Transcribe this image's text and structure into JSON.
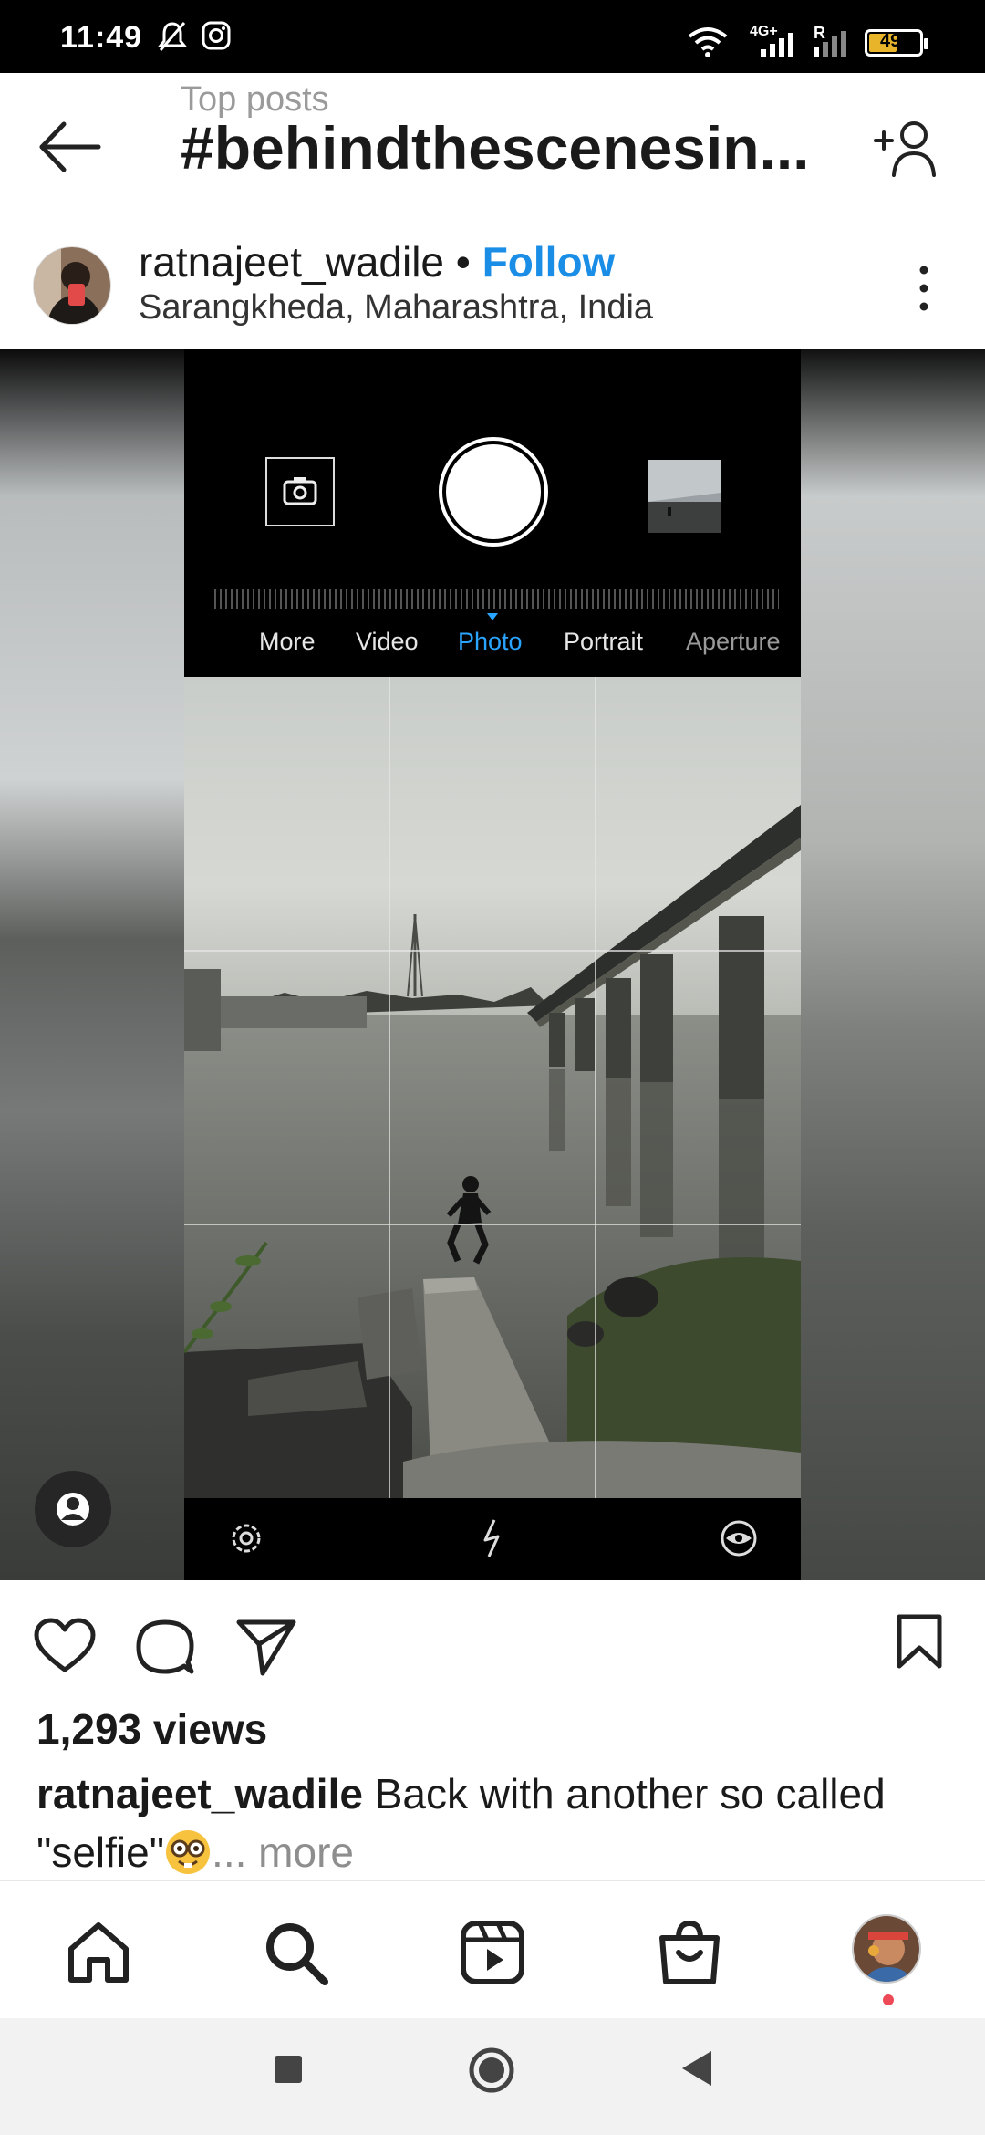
{
  "status_bar": {
    "time": "11:49",
    "network_label": "4G+",
    "roaming_label": "R",
    "battery": "49",
    "icons": [
      "bell-off-icon",
      "instagram-icon",
      "wifi-icon",
      "signal-icon",
      "battery-icon"
    ]
  },
  "header": {
    "subtitle": "Top posts",
    "title": "#behindthescenesin...",
    "icons": [
      "back-arrow-icon",
      "add-person-icon"
    ]
  },
  "post": {
    "username": "ratnajeet_wadile",
    "separator": "•",
    "follow_label": "Follow",
    "location": "Sarangkheda, Maharashtra, India",
    "camera_modes": [
      "More",
      "Video",
      "Photo",
      "Portrait",
      "Aperture"
    ],
    "active_mode": "Photo",
    "views": "1,293 views",
    "caption_user": "ratnajeet_wadile",
    "caption_text": "Back with another so called \"selfie\"",
    "caption_emoji": "nerd-face-emoji",
    "caption_more": "... more"
  },
  "colors": {
    "accent": "#1a8ee6",
    "camera_mode_active": "#2aa5ff",
    "notification_dot": "#ed4956"
  },
  "bottom_nav": {
    "items": [
      "home-icon",
      "search-icon",
      "reels-icon",
      "shop-icon",
      "profile-avatar"
    ]
  },
  "android_nav": {
    "items": [
      "recents-square-icon",
      "home-circle-icon",
      "back-triangle-icon"
    ]
  }
}
